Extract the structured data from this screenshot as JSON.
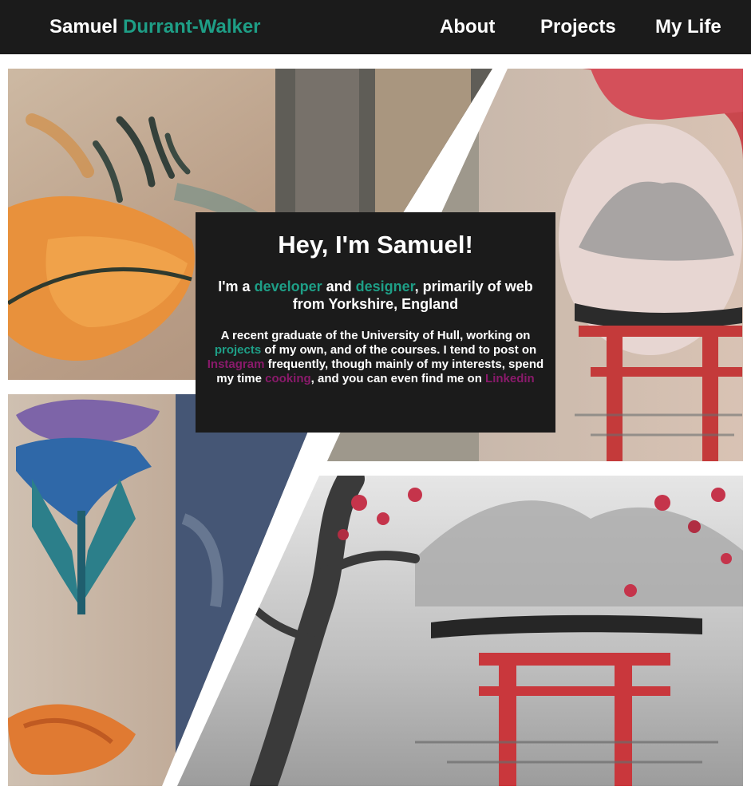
{
  "header": {
    "brand_first": "Samuel",
    "brand_last": "Durrant-Walker",
    "nav": {
      "about": "About",
      "projects": "Projects",
      "mylife": "My Life"
    }
  },
  "intro": {
    "title": "Hey, I'm Samuel!",
    "sub_1": "I'm a ",
    "sub_link_developer": "developer",
    "sub_2": " and ",
    "sub_link_designer": "designer",
    "sub_3": ", primarily of web from Yorkshire, England",
    "body_1": "A recent graduate of the University of Hull, working on ",
    "body_link_projects": "projects",
    "body_2": " of my own, and of the courses. I tend to post on ",
    "body_link_instagram": "Instagram",
    "body_3": " frequently, though mainly of my interests, spend my time ",
    "body_link_cooking": "cooking",
    "body_4": ", and you can even find me on ",
    "body_link_linkedin": "Linkedin"
  },
  "colors": {
    "navbar_bg": "#1b1b1b",
    "accent_teal": "#1e9e86",
    "link_purple": "#8a1a6b"
  },
  "collage_images": [
    "koi-tattoo-photo",
    "torii-tattoo-photo",
    "firefly-tattoo-photo",
    "torii-blossom-painting"
  ]
}
